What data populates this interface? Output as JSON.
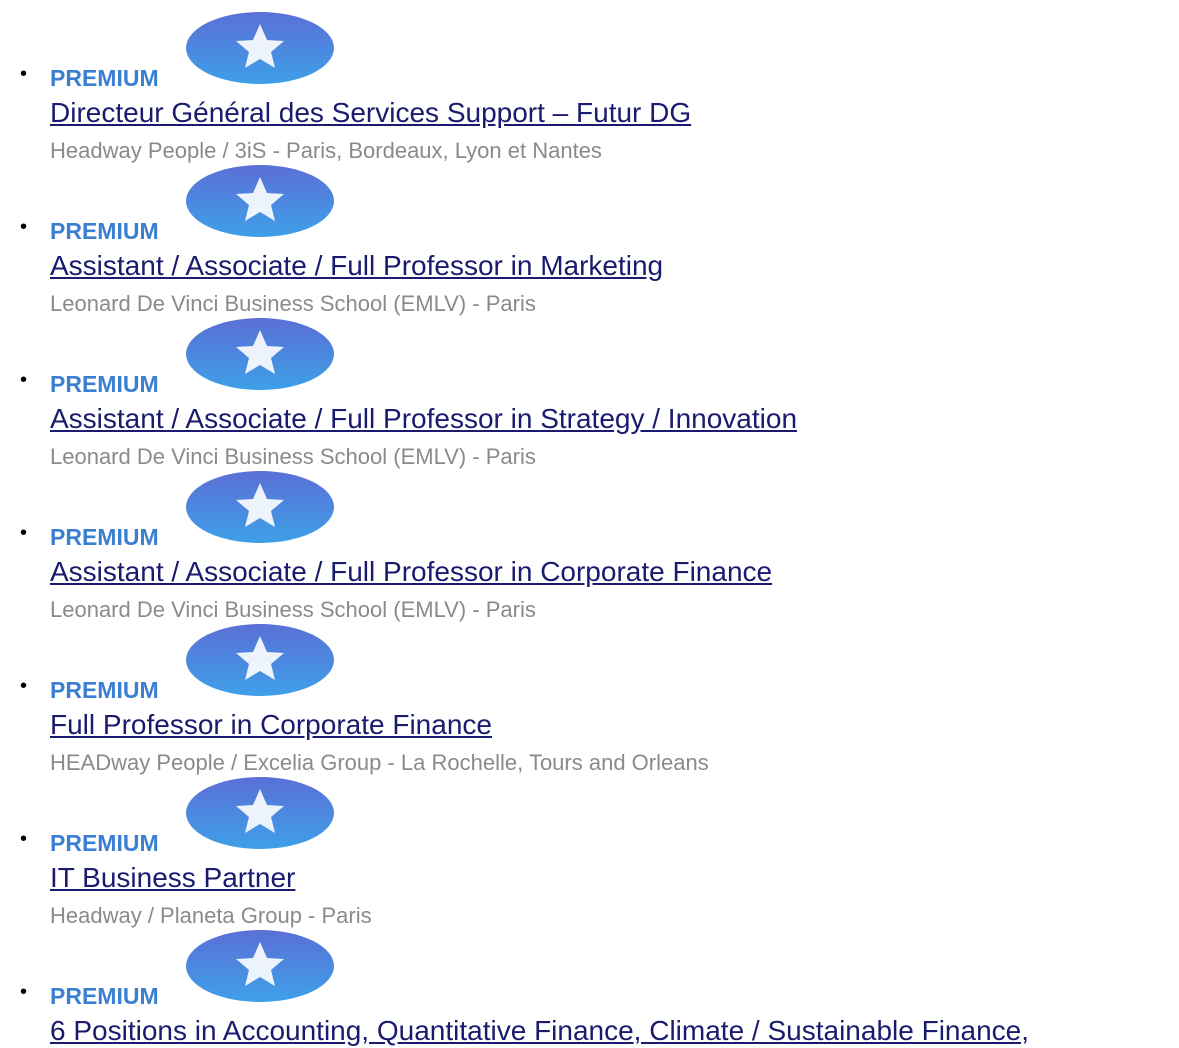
{
  "badge": {
    "label": "PREMIUM",
    "icon": "star-badge-icon",
    "label_color": "#3b7fd3",
    "icon_color_top": "#5b6fd6",
    "icon_color_bottom": "#3ea0e8"
  },
  "jobs": [
    {
      "title": "Directeur Général des Services Support – Futur DG",
      "meta": "Headway People / 3iS - Paris, Bordeaux, Lyon et Nantes"
    },
    {
      "title": "Assistant / Associate / Full Professor in Marketing",
      "meta": "Leonard De Vinci Business School (EMLV) - Paris"
    },
    {
      "title": "Assistant / Associate / Full Professor in Strategy / Innovation",
      "meta": "Leonard De Vinci Business School (EMLV) - Paris"
    },
    {
      "title": "Assistant / Associate / Full Professor in Corporate Finance",
      "meta": "Leonard De Vinci Business School (EMLV) - Paris"
    },
    {
      "title": "Full Professor in Corporate Finance",
      "meta": "HEADway People / Excelia Group - La Rochelle, Tours and Orleans"
    },
    {
      "title": "IT Business Partner",
      "meta": "Headway / Planeta Group - Paris"
    },
    {
      "title": "6 Positions in Accounting, Quantitative Finance, Climate / Sustainable Finance,",
      "meta": ""
    }
  ]
}
